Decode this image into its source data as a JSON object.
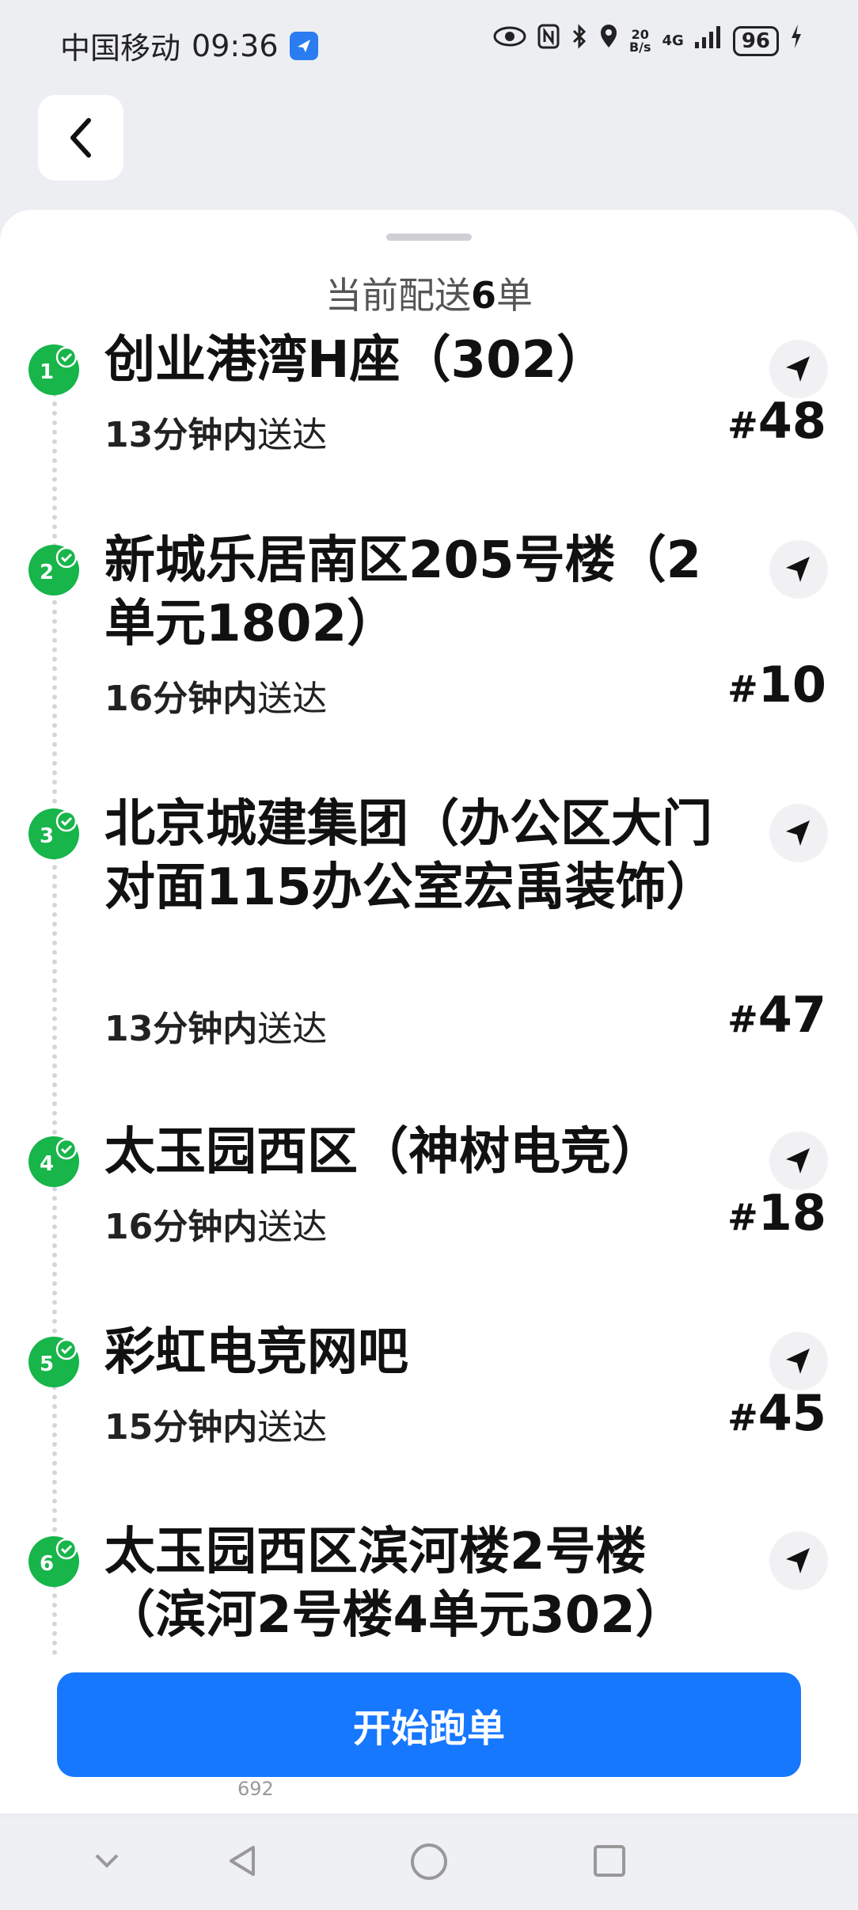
{
  "status_bar": {
    "carrier": "中国移动",
    "time": "09:36",
    "net_speed_value": "20",
    "net_speed_unit": "B/s",
    "network": "4G",
    "battery": "96"
  },
  "header": {
    "back_icon": "chevron-left-icon"
  },
  "sheet": {
    "title_prefix": "当前配送",
    "title_count": "6",
    "title_suffix": "单"
  },
  "orders": [
    {
      "index": "1",
      "address": "创业港湾H座（302）",
      "eta_minutes": "13分钟内",
      "eta_suffix": "送达",
      "order_no": "48"
    },
    {
      "index": "2",
      "address": "新城乐居南区205号楼（2单元1802）",
      "eta_minutes": "16分钟内",
      "eta_suffix": "送达",
      "order_no": "10"
    },
    {
      "index": "3",
      "address": "北京城建集团（办公区大门对面115办公室宏禹装饰）",
      "eta_minutes": "13分钟内",
      "eta_suffix": "送达",
      "order_no": "47"
    },
    {
      "index": "4",
      "address": "太玉园西区（神树电竞）",
      "eta_minutes": "16分钟内",
      "eta_suffix": "送达",
      "order_no": "18"
    },
    {
      "index": "5",
      "address": "彩虹电竞网吧",
      "eta_minutes": "15分钟内",
      "eta_suffix": "送达",
      "order_no": "45"
    },
    {
      "index": "6",
      "address": "太玉园西区滨河楼2号楼（滨河2号楼4单元302）",
      "eta_minutes": "",
      "eta_suffix": "",
      "order_no": ""
    }
  ],
  "hash": "#",
  "start_button": "开始跑单",
  "under_text": "692",
  "accent_color": "#1677ff",
  "badge_color": "#17b54a"
}
